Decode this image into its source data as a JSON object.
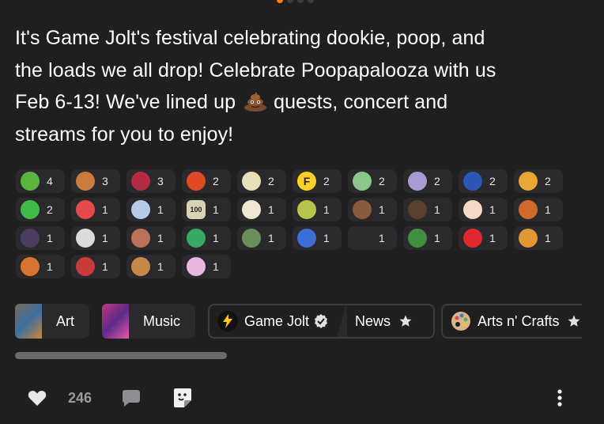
{
  "post": {
    "line1": "It's Game Jolt's festival celebrating dookie, poop, and",
    "line2": "the loads we all drop! Celebrate Poopapalooza with us",
    "line3a": "Feb 6-13! We've lined up",
    "line3b": "quests, concert and",
    "line4": "streams for you to enjoy!"
  },
  "stickers": [
    {
      "icon": "green-blob-sticker-icon",
      "color": "#5ab53f",
      "glyph": "",
      "count": "4"
    },
    {
      "icon": "dynamite-sticker-icon",
      "color": "#c87b3a",
      "glyph": "",
      "count": "3"
    },
    {
      "icon": "red-face-sticker-icon",
      "color": "#b72a43",
      "glyph": "",
      "count": "3"
    },
    {
      "icon": "red-apple-sticker-icon",
      "color": "#e04b26",
      "glyph": "",
      "count": "2"
    },
    {
      "icon": "cartoon-duck-sticker-icon",
      "color": "#e8e0b8",
      "glyph": "",
      "count": "2"
    },
    {
      "icon": "letter-f-sticker-icon",
      "color": "#ffd21e",
      "glyph": "F",
      "count": "2"
    },
    {
      "icon": "green-dino-sticker-icon",
      "color": "#8cc78a",
      "glyph": "",
      "count": "2"
    },
    {
      "icon": "reaper-sticker-icon",
      "color": "#a89bd0",
      "glyph": "",
      "count": "2"
    },
    {
      "icon": "blue-hedgehog-sticker-icon",
      "color": "#2c56b8",
      "glyph": "",
      "count": "2"
    },
    {
      "icon": "yellow-face-sticker-icon",
      "color": "#e8a732",
      "glyph": "",
      "count": "2"
    },
    {
      "icon": "green-alien-sticker-icon",
      "color": "#3dbb48",
      "glyph": "",
      "count": "2"
    },
    {
      "icon": "flamethrower-sticker-icon",
      "color": "#e84a4a",
      "glyph": "",
      "count": "1"
    },
    {
      "icon": "blue-bubble-sticker-icon",
      "color": "#b8cbe6",
      "glyph": "",
      "count": "1"
    },
    {
      "icon": "100-badge-sticker-icon",
      "color": "#d8d2b6",
      "glyph": "100",
      "count": "1"
    },
    {
      "icon": "crowned-face-sticker-icon",
      "color": "#efe7d2",
      "glyph": "",
      "count": "1"
    },
    {
      "icon": "doodle-creature-sticker-icon",
      "color": "#b7c64a",
      "glyph": "",
      "count": "1"
    },
    {
      "icon": "brown-bear-sticker-icon",
      "color": "#8a5a3a",
      "glyph": "",
      "count": "1"
    },
    {
      "icon": "bearded-man-sticker-icon",
      "color": "#5a4030",
      "glyph": "",
      "count": "1"
    },
    {
      "icon": "pink-puff-sticker-icon",
      "color": "#f2d9c8",
      "glyph": "",
      "count": "1"
    },
    {
      "icon": "pumpkin-sticker-icon",
      "color": "#d06b2a",
      "glyph": "",
      "count": "1"
    },
    {
      "icon": "top-hat-sticker-icon",
      "color": "#4a3d5e",
      "glyph": "",
      "count": "1"
    },
    {
      "icon": "bowtie-sticker-icon",
      "color": "#dcdcdc",
      "glyph": "",
      "count": "1"
    },
    {
      "icon": "mustache-man-sticker-icon",
      "color": "#b8735a",
      "glyph": "",
      "count": "1"
    },
    {
      "icon": "green-slime-sticker-icon",
      "color": "#38a866",
      "glyph": "",
      "count": "1"
    },
    {
      "icon": "retro-console-sticker-icon",
      "color": "#6a8f5a",
      "glyph": "",
      "count": "1"
    },
    {
      "icon": "blue-swirl-sticker-icon",
      "color": "#3a6ed8",
      "glyph": "",
      "count": "1"
    },
    {
      "icon": "black-hat-sticker-icon",
      "color": "#2a2a2a",
      "glyph": "",
      "count": "1"
    },
    {
      "icon": "creeper-sticker-icon",
      "color": "#3f8f3f",
      "glyph": "",
      "count": "1"
    },
    {
      "icon": "red-bird-sticker-icon",
      "color": "#e0292e",
      "glyph": "",
      "count": "1"
    },
    {
      "icon": "orange-burger-sticker-icon",
      "color": "#e09830",
      "glyph": "",
      "count": "1"
    },
    {
      "icon": "orange-monster-sticker-icon",
      "color": "#d8742f",
      "glyph": "",
      "count": "1"
    },
    {
      "icon": "candy-heart-sticker-icon",
      "color": "#c83b3b",
      "glyph": "",
      "count": "1"
    },
    {
      "icon": "brown-phone-sticker-icon",
      "color": "#c48a4a",
      "glyph": "",
      "count": "1"
    },
    {
      "icon": "pink-clock-sticker-icon",
      "color": "#e6b8e0",
      "glyph": "",
      "count": "1"
    }
  ],
  "tags": {
    "art": "Art",
    "music": "Music",
    "community": "Game Jolt",
    "channel": "News",
    "arts": "Arts n' Crafts"
  },
  "actions": {
    "like_count": "246"
  },
  "colors": {
    "background": "#1f1f20",
    "accent": "#ff7a19",
    "chip": "#2a2a2d"
  }
}
